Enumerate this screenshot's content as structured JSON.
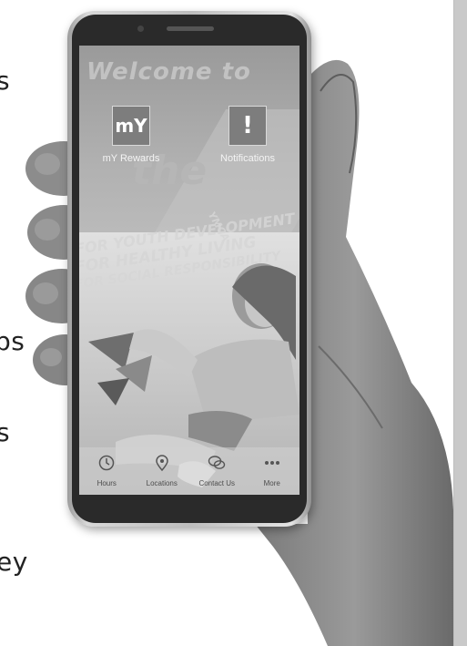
{
  "side_text": [
    "s",
    "ps",
    "s",
    "ey"
  ],
  "app": {
    "banner_words": [
      "Welcome to",
      "the"
    ],
    "faded_lines": [
      "FOR YOUTH DEVELOPMENT",
      "FOR HEALTHY LIVING",
      "FOR SOCIAL RESPONSIBILITY"
    ],
    "ymca_mark": "YMCA",
    "tiles": [
      {
        "icon_text": "mY",
        "label": "mY Rewards"
      },
      {
        "icon_text": "!",
        "label": "Notifications"
      }
    ],
    "bottom_nav": [
      {
        "icon": "clock-icon",
        "label": "Hours"
      },
      {
        "icon": "map-pin-icon",
        "label": "Locations"
      },
      {
        "icon": "chat-bubbles-icon",
        "label": "Contact Us"
      },
      {
        "icon": "more-dots-icon",
        "label": "More"
      }
    ]
  },
  "colors": {
    "screen_tint": "#a8a8a8",
    "nav_text": "#4c4c4c",
    "tile_box": "#7d7d7d"
  }
}
